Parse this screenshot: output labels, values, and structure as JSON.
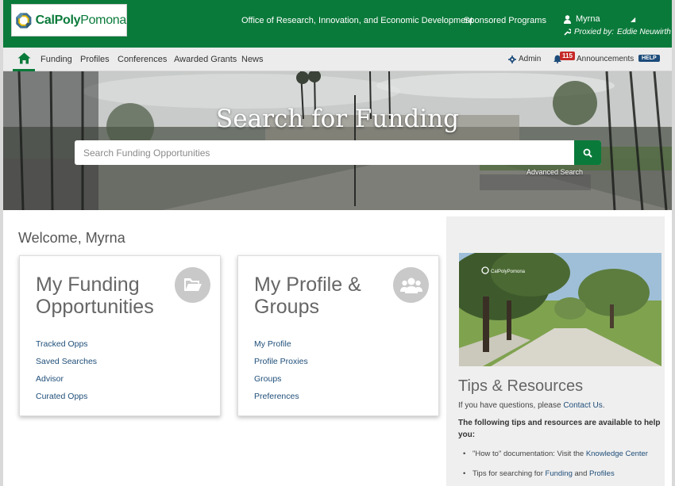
{
  "header": {
    "logo_text_cal": "CalPoly",
    "logo_text_pomona": "Pomona",
    "office_link": "Office of Research, Innovation, and Economic Development",
    "sponsored_link": "Sponsored Programs",
    "user_name": "Myrna",
    "proxied_label": "Proxied by:",
    "proxied_name": "Eddie Neuwirth"
  },
  "nav": {
    "items": [
      "Funding",
      "Profiles",
      "Conferences",
      "Awarded Grants",
      "News"
    ],
    "admin_label": "Admin",
    "announcements_label": "Announcements",
    "announcements_count": "115",
    "help_label": "HELP"
  },
  "hero": {
    "title": "Search for Funding",
    "search_placeholder": "Search Funding Opportunities",
    "advanced_search": "Advanced Search"
  },
  "main": {
    "welcome": "Welcome, Myrna",
    "cards": [
      {
        "title_line1": "My Funding",
        "title_line2": "Opportunities",
        "icon": "folder-open-icon",
        "links": [
          "Tracked Opps",
          "Saved Searches",
          "Advisor",
          "Curated Opps"
        ]
      },
      {
        "title_line1": "My Profile &",
        "title_line2": "Groups",
        "icon": "users-icon",
        "links": [
          "My Profile",
          "Profile Proxies",
          "Groups",
          "Preferences"
        ]
      }
    ]
  },
  "tips": {
    "photo_logo": "CalPolyPomona",
    "title": "Tips & Resources",
    "question_prefix": "If you have questions, please",
    "question_link": "Contact Us",
    "question_suffix": ".",
    "intro": "The following tips and resources are available to help you:",
    "item1_prefix": "\"How to\" documentation: Visit the",
    "item1_link": "Knowledge Center",
    "item2_prefix": "Tips for searching for",
    "item2_link1": "Funding",
    "item2_and": "and",
    "item2_link2": "Profiles"
  },
  "colors": {
    "brand_green": "#0a7a3a",
    "link_blue": "#1f4e79",
    "help_blue": "#1c4b7a",
    "badge_red": "#c62828"
  }
}
